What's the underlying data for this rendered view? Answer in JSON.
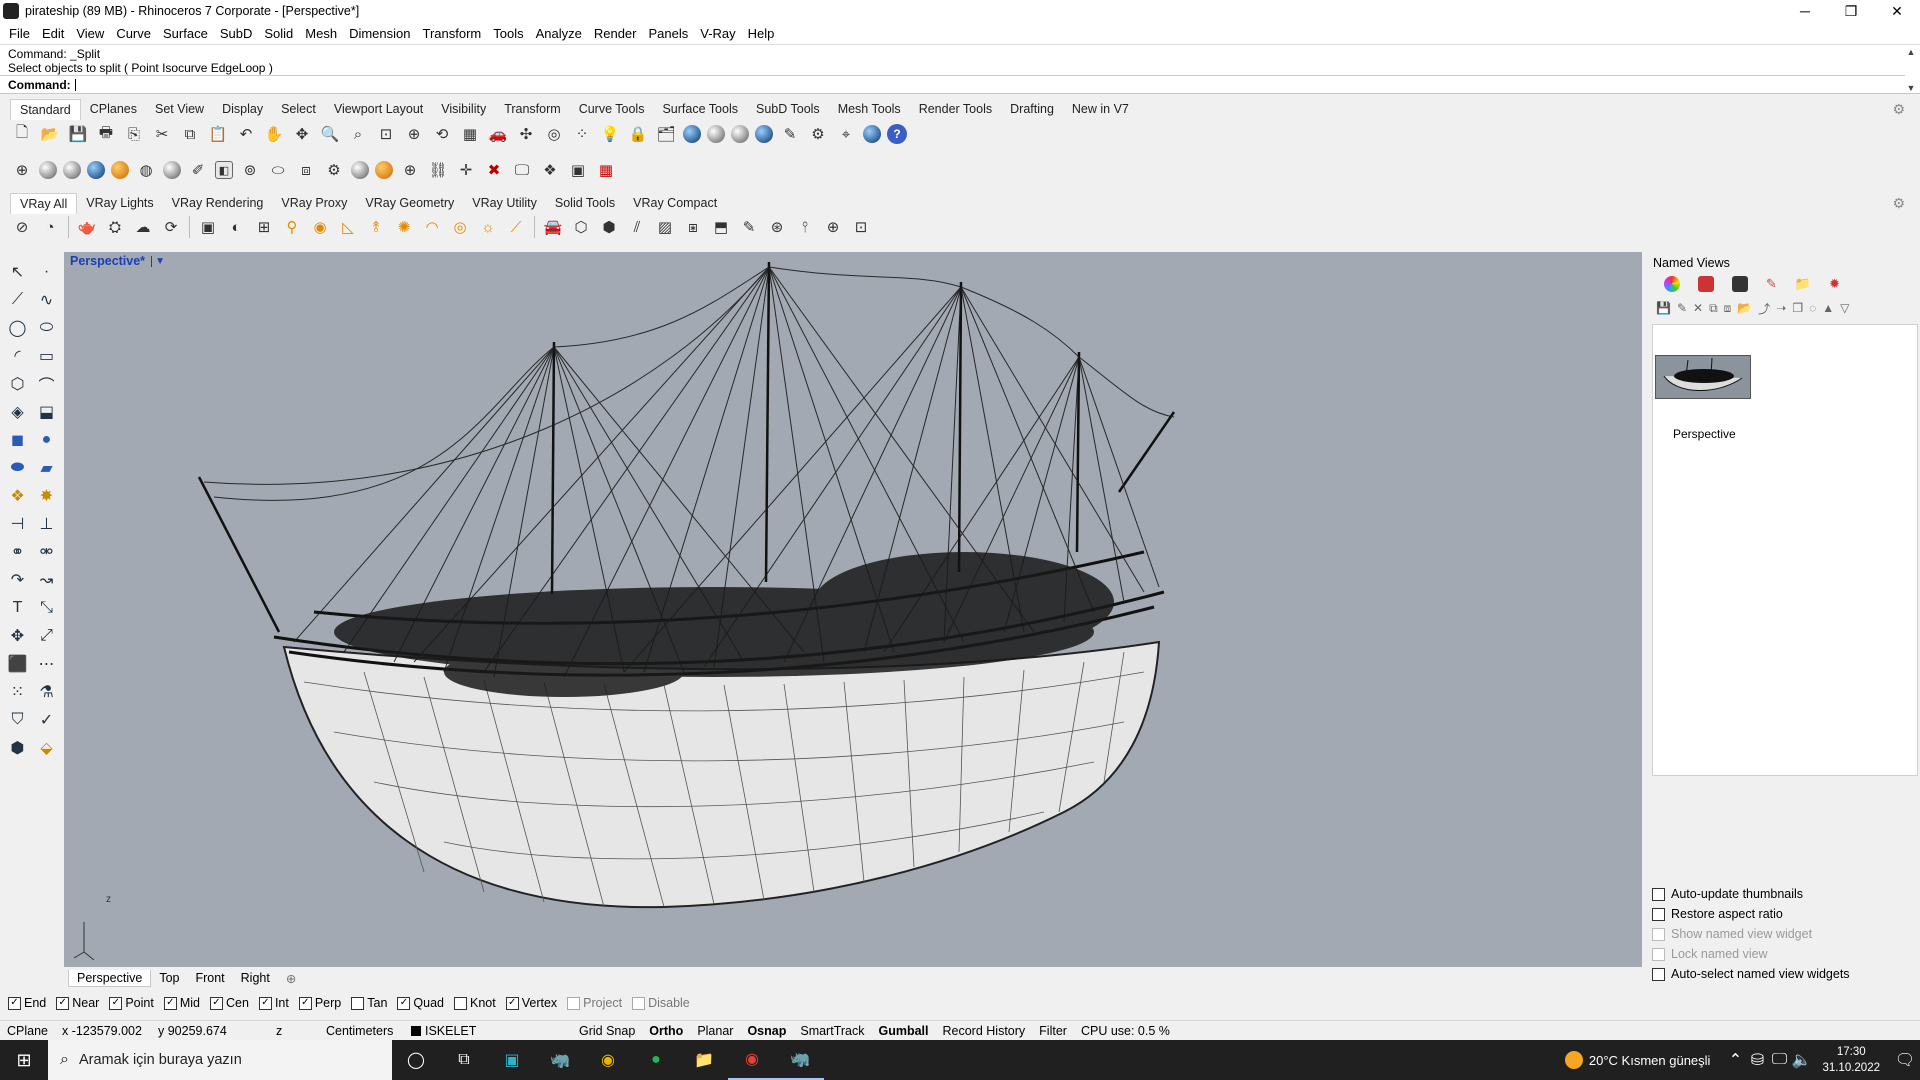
{
  "window": {
    "title": "pirateship (89 MB) - Rhinoceros 7 Corporate - [Perspective*]",
    "minimize": "─",
    "restore": "❐",
    "close": "✕"
  },
  "menu": [
    "File",
    "Edit",
    "View",
    "Curve",
    "Surface",
    "SubD",
    "Solid",
    "Mesh",
    "Dimension",
    "Transform",
    "Tools",
    "Analyze",
    "Render",
    "Panels",
    "V-Ray",
    "Help"
  ],
  "command": {
    "history_1": "Command: _Split",
    "history_2": "Select objects to split ( Point  Isocurve  EdgeLoop )",
    "prompt": "Command:"
  },
  "toolbar_tabs": [
    "Standard",
    "CPlanes",
    "Set View",
    "Display",
    "Select",
    "Viewport Layout",
    "Visibility",
    "Transform",
    "Curve Tools",
    "Surface Tools",
    "SubD Tools",
    "Mesh Tools",
    "Render Tools",
    "Drafting",
    "New in V7"
  ],
  "vray_tabs": [
    "VRay All",
    "VRay Lights",
    "VRay Rendering",
    "VRay Proxy",
    "VRay Geometry",
    "VRay Utility",
    "Solid Tools",
    "VRay Compact"
  ],
  "viewport": {
    "title": "Perspective*",
    "axis_z": "z"
  },
  "viewport_tabs": [
    "Perspective",
    "Top",
    "Front",
    "Right"
  ],
  "named_views": {
    "title": "Named Views",
    "view_name": "Perspective",
    "options": [
      {
        "label": "Auto-update thumbnails",
        "enabled": true
      },
      {
        "label": "Restore aspect ratio",
        "enabled": true
      },
      {
        "label": "Show named view widget",
        "enabled": false
      },
      {
        "label": "Lock named view",
        "enabled": false
      },
      {
        "label": "Auto-select named view widgets",
        "enabled": true
      }
    ]
  },
  "osnap": [
    {
      "label": "End",
      "checked": true
    },
    {
      "label": "Near",
      "checked": true
    },
    {
      "label": "Point",
      "checked": true
    },
    {
      "label": "Mid",
      "checked": true
    },
    {
      "label": "Cen",
      "checked": true
    },
    {
      "label": "Int",
      "checked": true
    },
    {
      "label": "Perp",
      "checked": true
    },
    {
      "label": "Tan",
      "checked": false
    },
    {
      "label": "Quad",
      "checked": true
    },
    {
      "label": "Knot",
      "checked": false
    },
    {
      "label": "Vertex",
      "checked": true
    },
    {
      "label": "Project",
      "checked": false
    },
    {
      "label": "Disable",
      "checked": false
    }
  ],
  "status": {
    "cplane": "CPlane",
    "x": "x -123579.002",
    "y": "y 90259.674",
    "z": "z",
    "units": "Centimeters",
    "layer": "ISKELET",
    "grid_snap": "Grid Snap",
    "ortho": "Ortho",
    "planar": "Planar",
    "osnap": "Osnap",
    "smarttrack": "SmartTrack",
    "gumball": "Gumball",
    "record_history": "Record History",
    "filter": "Filter",
    "cpu": "CPU use: 0.5 %"
  },
  "taskbar": {
    "search_placeholder": "Aramak için buraya yazın",
    "weather": "20°C  Kısmen güneşli",
    "time": "17:30",
    "date": "31.10.2022"
  },
  "colors": {
    "viewport_bg": "#a2a9b2",
    "active_view_title": "#1c3fb3",
    "taskbar": "#202020"
  }
}
